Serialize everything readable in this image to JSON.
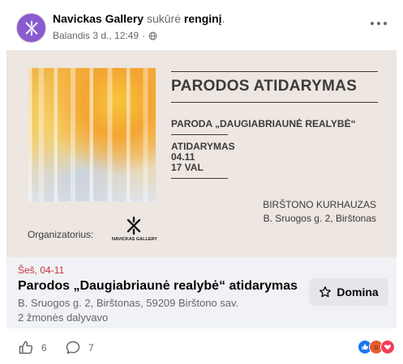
{
  "post": {
    "page_name": "Navickas Gallery",
    "action_text": " sukūrė ",
    "object_text": "renginį",
    "object_suffix": ".",
    "timestamp": "Balandis 3 d., 12:49",
    "separator": "·",
    "privacy_icon": "globe-icon",
    "more_icon": "more-options-icon"
  },
  "poster": {
    "heading": "PARODOS ATIDARYMAS",
    "subheading": "PARODA „DAUGIABRIAUNĖ REALYBĖ“",
    "opening_label": "ATIDARYMAS",
    "opening_date": "04.11",
    "opening_time": "17 VAL",
    "venue_name": "BIRŠTONO KURHAUZAS",
    "venue_address": "B. Sruogos g. 2, Birštonas",
    "organizer_label": "Organizatorius:",
    "organizer_logo_text": "NAVICKAS GALLERY",
    "colors": {
      "background": "#ede6e1",
      "text": "#3b3b3b"
    }
  },
  "event": {
    "date": "Šeš, 04-11",
    "title": "Parodos „Daugiabriaunė realybė“ atidarymas",
    "location": "B. Sruogos g. 2, Birštonas, 59209 Birštono sav.",
    "attendance": "2 žmonės dalyvavo",
    "interested_label": "Domina",
    "interested_icon": "star-icon",
    "date_color": "#c8303f"
  },
  "footer": {
    "likes_count": "6",
    "comments_count": "7",
    "reactions": [
      "like",
      "angry",
      "love"
    ]
  }
}
